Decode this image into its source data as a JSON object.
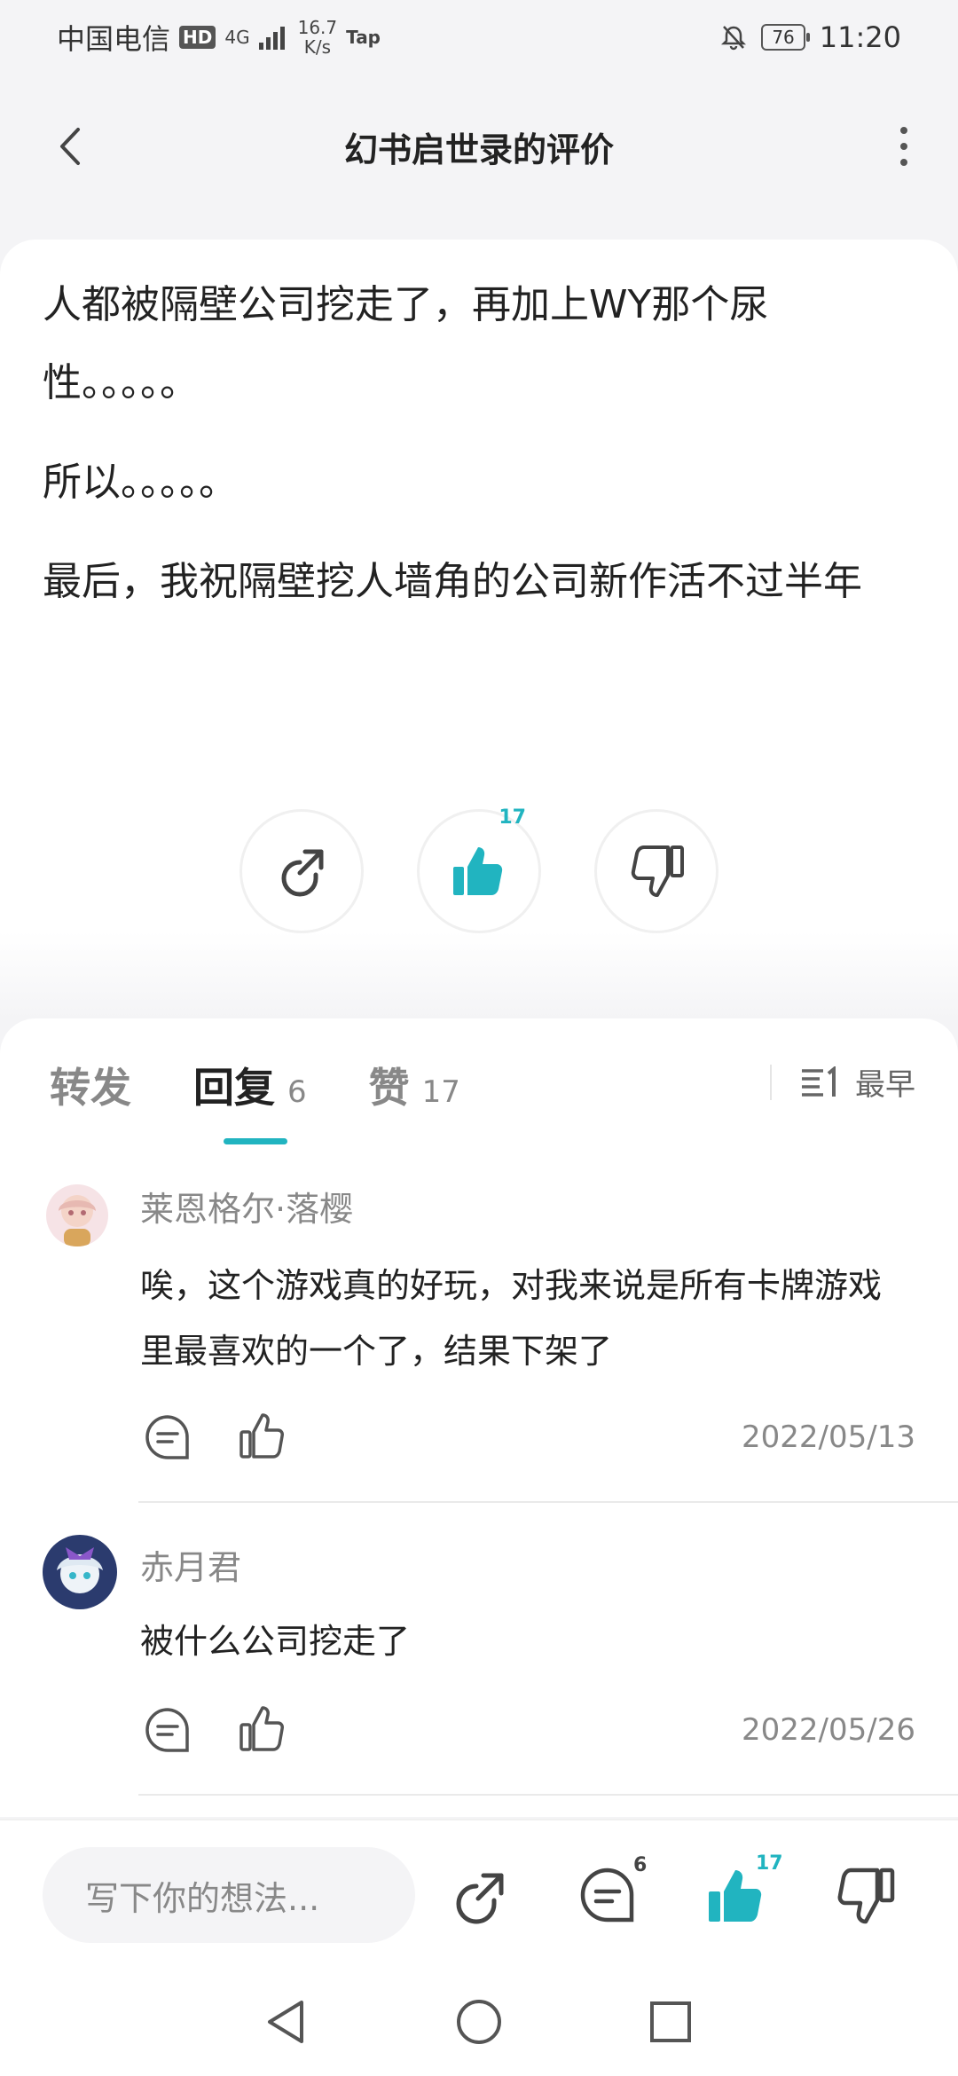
{
  "status_bar": {
    "carrier": "中国电信",
    "hd": "HD",
    "network": "4G",
    "speed_value": "16.7",
    "speed_unit": "K/s",
    "app_badge": "Tap",
    "battery": "76",
    "time": "11:20"
  },
  "header": {
    "title": "幻书启世录的评价"
  },
  "review": {
    "paragraphs": [
      "人都被隔壁公司挖走了，再加上WY那个尿性。。。。。",
      "所以。。。。。",
      "最后，我祝隔壁挖人墙角的公司新作活不过半年"
    ]
  },
  "actions": {
    "like_count": "17"
  },
  "tabs": {
    "items": [
      {
        "label": "转发",
        "count": ""
      },
      {
        "label": "回复",
        "count": "6"
      },
      {
        "label": "赞",
        "count": "17"
      }
    ],
    "active": "回复"
  },
  "sort": {
    "label": "最早"
  },
  "comments": [
    {
      "author": "莱恩格尔·落樱",
      "text": "唉，这个游戏真的好玩，对我来说是所有卡牌游戏里最喜欢的一个了，结果下架了",
      "date": "2022/05/13"
    },
    {
      "author": "赤月君",
      "text": "被什么公司挖走了",
      "date": "2022/05/26"
    }
  ],
  "bottom_bar": {
    "placeholder": "写下你的想法...",
    "reply_count": "6",
    "like_count": "17"
  },
  "colors": {
    "accent": "#21b4c0",
    "background": "#f4f4f6"
  }
}
